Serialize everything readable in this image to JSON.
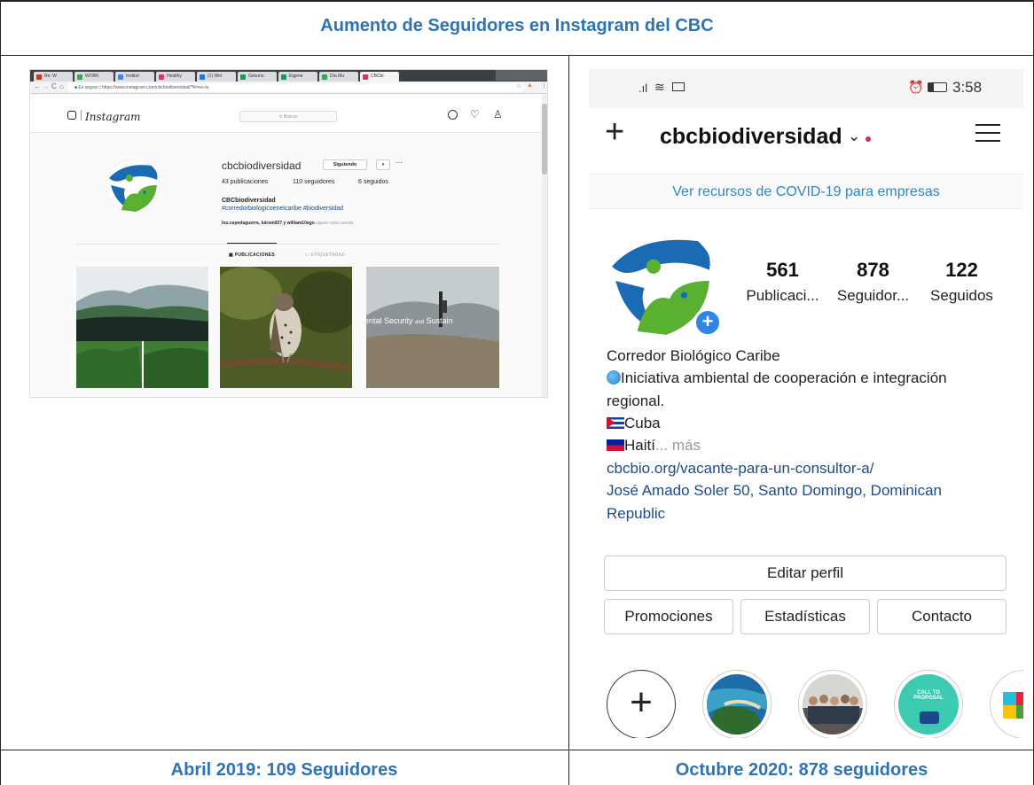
{
  "title": "Aumento de Seguidores en Instagram del CBC",
  "captions": {
    "left": "Abril 2019: 109 Seguidores",
    "right": "Octubre 2020: 878 seguidores"
  },
  "desktop": {
    "tabs": [
      "Re: W",
      "WORK",
      "Institut",
      "Healthy",
      "(1) Wel",
      "Gesuno",
      "Eigene",
      "Día Mu",
      "CBCbi"
    ],
    "tab_colors": [
      "#d93025",
      "#34a853",
      "#4285f4",
      "#e1306c",
      "#1877f2",
      "#0f9d58",
      "#0f9d58",
      "#34a853",
      "#e1306c"
    ],
    "secure_label": "Es seguro",
    "url": "https://www.instagram.com/cbcbiodiversidad/?hl=es-la",
    "search_placeholder": "Buscar",
    "logo_text": "Instagram",
    "username": "cbcbiodiversidad",
    "follow_button": "Siguiendo",
    "more": "···",
    "posts": "43 publicaciones",
    "followers": "110 seguidores",
    "following": "6 seguidos",
    "name": "CBCbiodiversidad",
    "hashtags": "#corredorbiologicoenelcaribe #biodiversidad",
    "followed_by_names": "lou.cepedaguerra, luirom927 y william10ego",
    "followed_by_suffix": "siguen esta cuenta",
    "tab_posts": "PUBLICACIONES",
    "tab_tagged": "ETIQUETADAS",
    "thumb3_text_a": "ental Security",
    "thumb3_text_b": "and",
    "thumb3_text_c": "Sustain"
  },
  "phone": {
    "time": "3:58",
    "username": "cbcbiodiversidad",
    "covid_link": "Ver recursos de COVID-19 para empresas",
    "stats": [
      {
        "value": "561",
        "label": "Publicaci..."
      },
      {
        "value": "878",
        "label": "Seguidor..."
      },
      {
        "value": "122",
        "label": "Seguidos"
      }
    ],
    "name": "Corredor Biológico Caribe",
    "bio_line1": "Iniciativa ambiental de cooperación e integración",
    "bio_line2": "regional.",
    "cuba": "Cuba",
    "haiti": "Haití",
    "more": "... más",
    "website": "cbcbio.org/vacante-para-un-consultor-a/",
    "address_line1": "José Amado Soler 50, Santo Domingo, Dominican",
    "address_line2": "Republic",
    "edit_profile": "Editar perfil",
    "buttons": [
      "Promociones",
      "Estadísticas",
      "Contacto"
    ],
    "story4_text": "CALL TO PROPOSAL"
  }
}
